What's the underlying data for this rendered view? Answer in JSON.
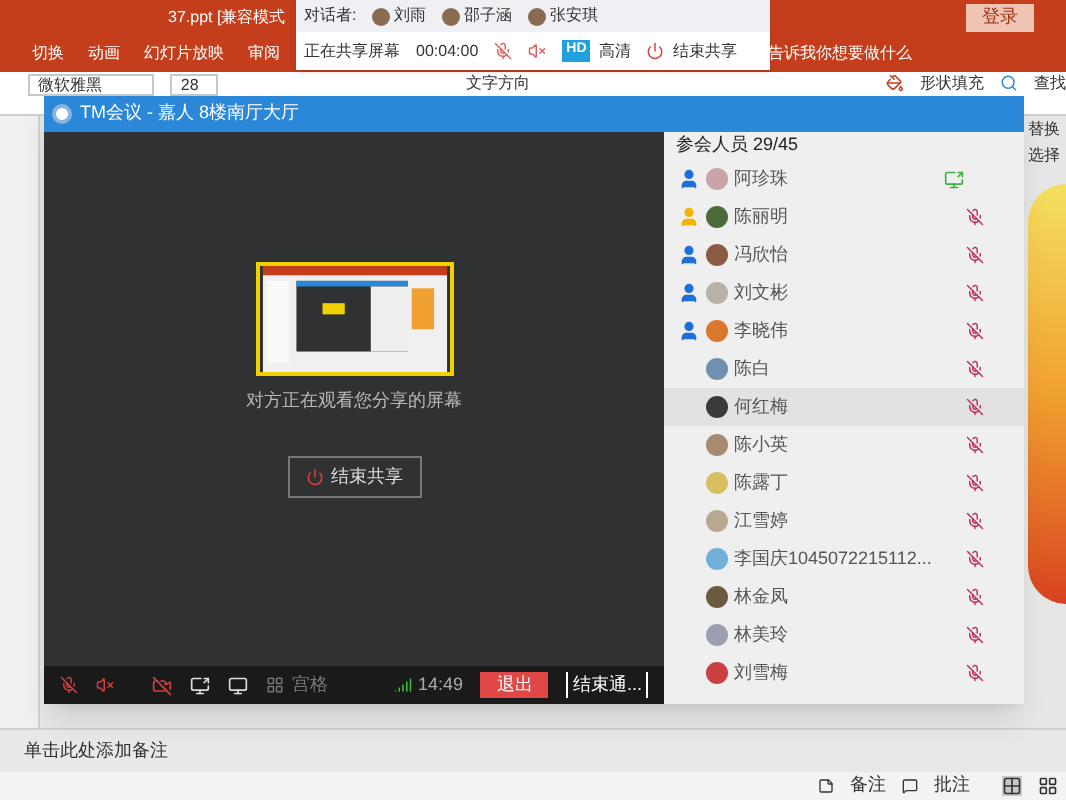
{
  "ppt": {
    "title": "37.ppt [兼容模式",
    "login": "登录",
    "tabs": [
      {
        "label": "切换"
      },
      {
        "label": "动画"
      },
      {
        "label": "幻灯片放映"
      },
      {
        "label": "审阅"
      },
      {
        "label": "告诉我你想要做什么"
      }
    ],
    "ribbon": {
      "font": "微软雅黑",
      "size": "28",
      "text_direction": "文字方向",
      "shape_fill": "形状填充",
      "find": "查找",
      "replace": "替换",
      "select": "选择"
    },
    "notes_placeholder": "单击此处添加备注",
    "status": {
      "notes": "备注",
      "comments": "批注"
    }
  },
  "floating_toolbar": {
    "label": "对话者:",
    "speakers": [
      {
        "name": "刘雨"
      },
      {
        "name": "邵子涵"
      },
      {
        "name": "张安琪"
      }
    ],
    "status": "正在共享屏幕",
    "timer": "00:04:00",
    "hd_badge": "HD",
    "hd_label": "高清",
    "end_share": "结束共享"
  },
  "meeting": {
    "title": "TM会议 - 嘉人 8楼南厅大厅",
    "share_caption": "对方正在观看您分享的屏幕",
    "end_share_button": "结束共享",
    "toolbar": {
      "grid_label": "宫格",
      "time": "14:49",
      "leave": "退出",
      "end_call": "结束通..."
    },
    "participants": {
      "header": "参会人员 29/45",
      "items": [
        {
          "name": "阿珍珠",
          "color": "#1e6fd9",
          "kind": "sharing",
          "selected": false
        },
        {
          "name": "陈丽明",
          "color": "#f2b400",
          "kind": "muted",
          "selected": false
        },
        {
          "name": "冯欣怡",
          "color": "#1e6fd9",
          "kind": "muted",
          "selected": false
        },
        {
          "name": "刘文彬",
          "color": "#1e6fd9",
          "kind": "muted",
          "selected": false
        },
        {
          "name": "李晓伟",
          "color": "#1e6fd9",
          "kind": "muted",
          "selected": false
        },
        {
          "name": "陈白",
          "kind": "muted",
          "selected": false
        },
        {
          "name": "何红梅",
          "kind": "muted",
          "selected": true
        },
        {
          "name": "陈小英",
          "kind": "muted",
          "selected": false
        },
        {
          "name": "陈露丁",
          "kind": "muted",
          "selected": false
        },
        {
          "name": "江雪婷",
          "kind": "muted",
          "selected": false
        },
        {
          "name": "李国庆1045072215112...",
          "kind": "muted",
          "selected": false
        },
        {
          "name": "林金凤",
          "kind": "muted",
          "selected": false
        },
        {
          "name": "林美玲",
          "kind": "muted",
          "selected": false
        },
        {
          "name": "刘雪梅",
          "kind": "muted",
          "selected": false
        }
      ]
    }
  }
}
